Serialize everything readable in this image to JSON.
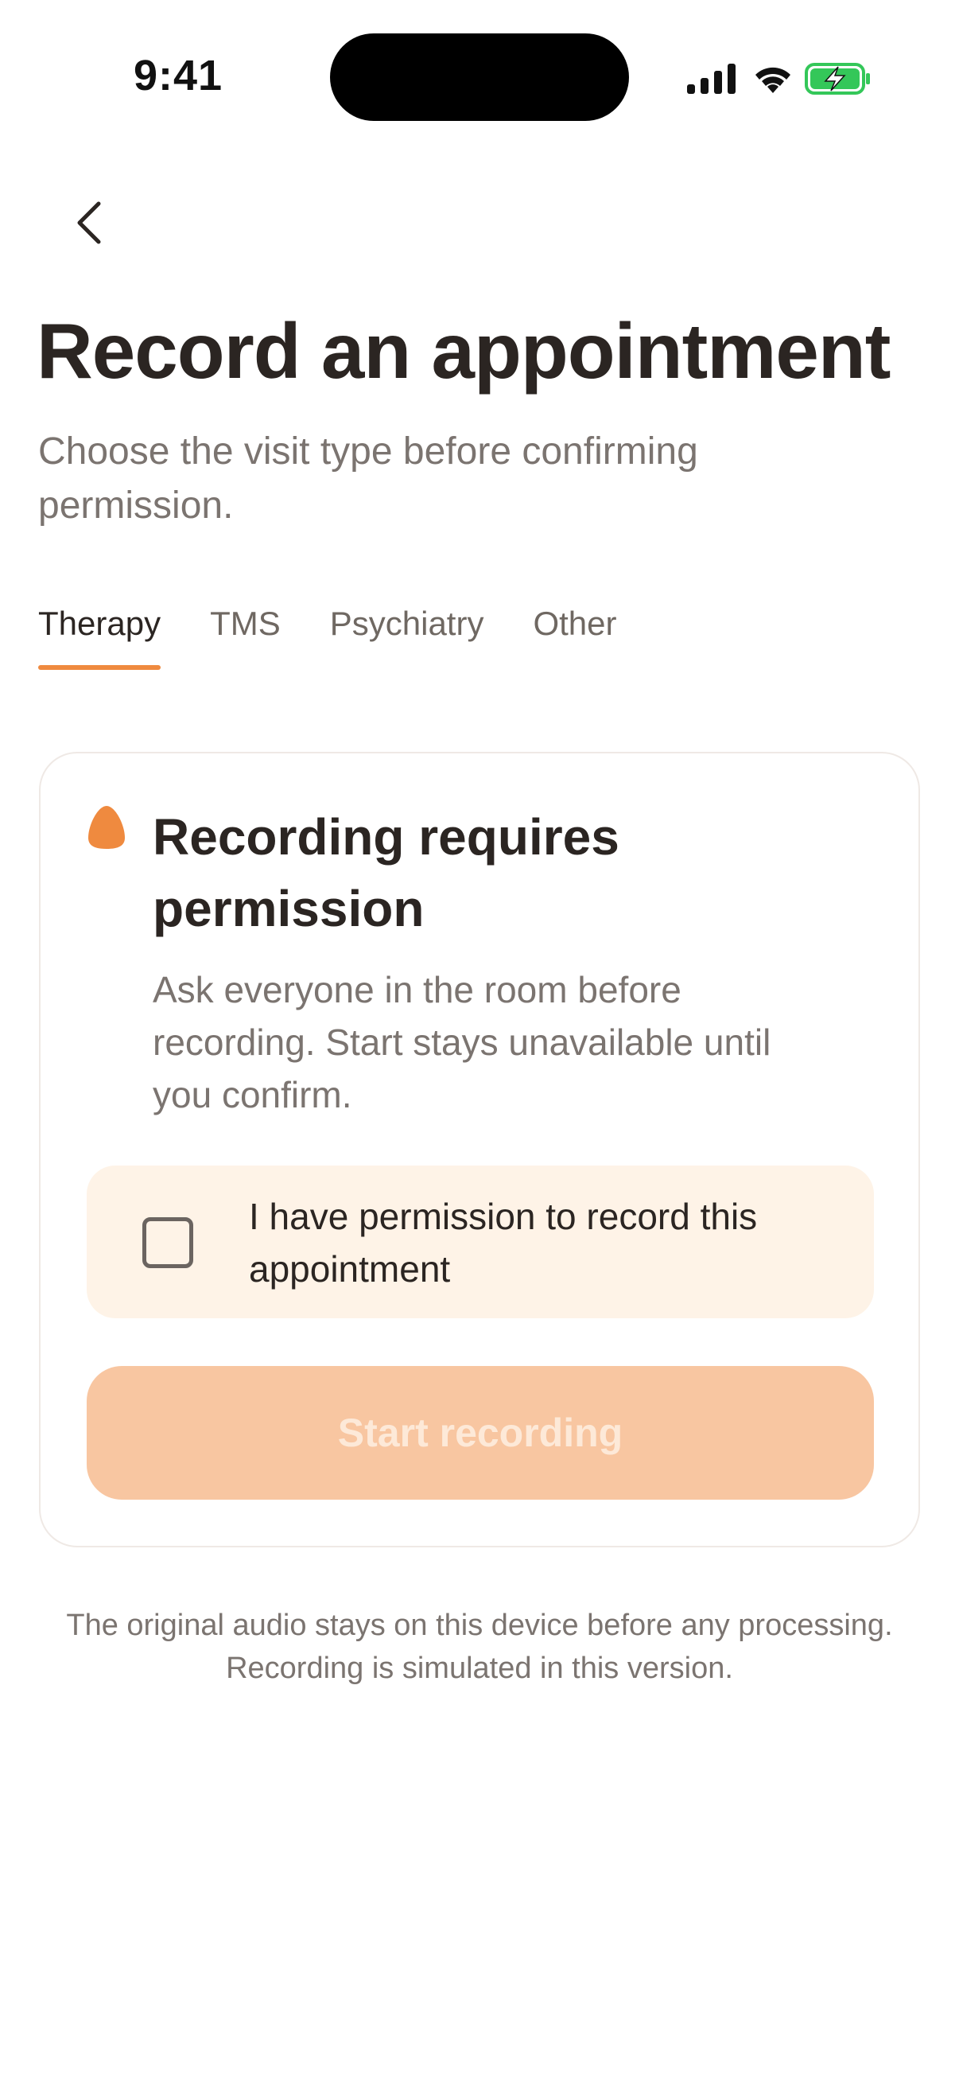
{
  "status_bar": {
    "time": "9:41",
    "battery_color": "#34c759"
  },
  "header": {
    "back_icon": "chevron-left-icon",
    "title": "Record an appointment",
    "subtitle": "Choose the visit type before confirming permission."
  },
  "tabs": [
    {
      "label": "Therapy",
      "active": true
    },
    {
      "label": "TMS",
      "active": false
    },
    {
      "label": "Psychiatry",
      "active": false
    },
    {
      "label": "Other",
      "active": false
    }
  ],
  "card": {
    "icon": "microphone-icon",
    "title": "Recording requires permission",
    "body": "Ask everyone in the room before recording. Start stays unavailable until you confirm.",
    "permission_checkbox": {
      "label": "I have permission to record this appointment",
      "checked": false
    },
    "start_button": {
      "label": "Start recording",
      "enabled": false
    }
  },
  "footer": {
    "note": "The original audio stays on this device before any processing. Recording is simulated in this version."
  },
  "colors": {
    "accent": "#ef8a3f",
    "accent_disabled": "#f8c6a1",
    "permission_bg": "#fef3e7",
    "text_primary": "#2b2522",
    "text_secondary": "#7b7470"
  }
}
